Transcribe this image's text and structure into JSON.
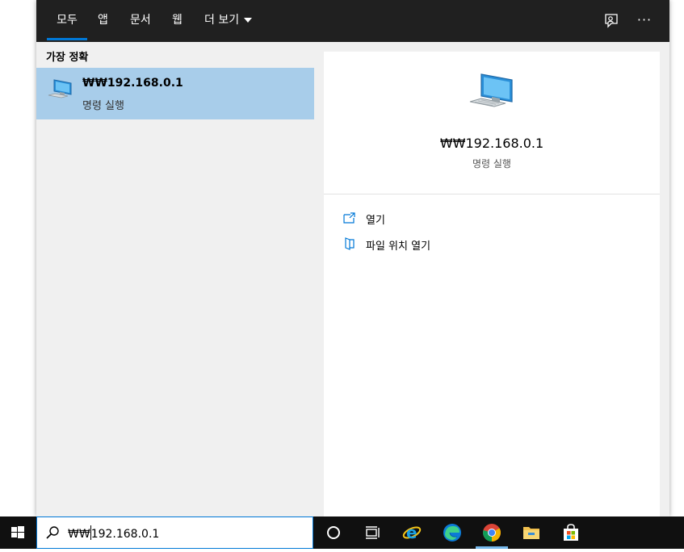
{
  "tabs": [
    {
      "label": "모두",
      "active": true
    },
    {
      "label": "앱"
    },
    {
      "label": "문서"
    },
    {
      "label": "웹"
    },
    {
      "label": "더 보기"
    }
  ],
  "best_match": {
    "heading": "가장 정확",
    "title": "₩₩192.168.0.1",
    "subtitle": "명령 실행",
    "icon": "computer-monitor-icon"
  },
  "detail": {
    "title": "₩₩192.168.0.1",
    "subtitle": "명령 실행",
    "actions": [
      {
        "label": "열기",
        "icon": "open-external-icon"
      },
      {
        "label": "파일 위치 열기",
        "icon": "file-location-icon"
      }
    ]
  },
  "search": {
    "query": "₩₩192.168.0.1"
  },
  "taskbar": {
    "pinned": [
      "cortana-icon",
      "task-view-icon",
      "internet-explorer-icon",
      "edge-icon",
      "chrome-icon",
      "file-explorer-icon",
      "store-icon"
    ],
    "active": "chrome-icon"
  },
  "colors": {
    "accent": "#0078d7",
    "selected_item": "#a8cdea",
    "topbar": "#202020",
    "taskbar": "#101010"
  }
}
